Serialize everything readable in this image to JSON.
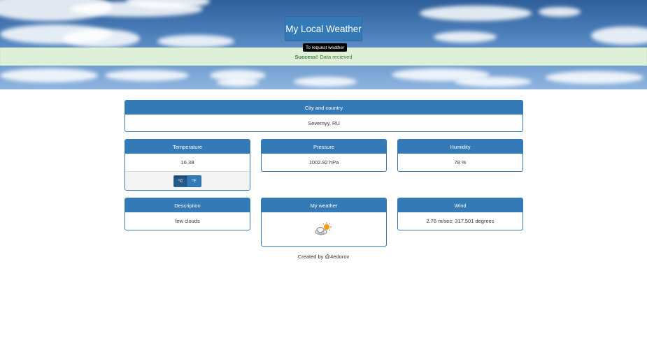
{
  "header": {
    "title": "My Local Weather",
    "tooltip": "To request weather"
  },
  "alert": {
    "strong": "Success!",
    "message": "Data recieved"
  },
  "panels": {
    "city": {
      "heading": "City and country",
      "value": "Severnyy, RU"
    },
    "temperature": {
      "heading": "Temperature",
      "value": "16.38",
      "unit_celsius": "°C",
      "unit_fahrenheit": "°F",
      "active_unit": "celsius"
    },
    "pressure": {
      "heading": "Pressure",
      "value": "1002.92 hPa"
    },
    "humidity": {
      "heading": "Humidity",
      "value": "78 %"
    },
    "description": {
      "heading": "Description",
      "value": "few clouds"
    },
    "my_weather": {
      "heading": "My weather",
      "icon": "cloud-sun-icon"
    },
    "wind": {
      "heading": "Wind",
      "value": "2.76 m/sec; 317.501 degrees"
    }
  },
  "footer": {
    "text": "Created by @4edorov"
  },
  "colors": {
    "primary": "#337ab7",
    "success_bg": "#dff0d8",
    "success_text": "#3c763d"
  }
}
